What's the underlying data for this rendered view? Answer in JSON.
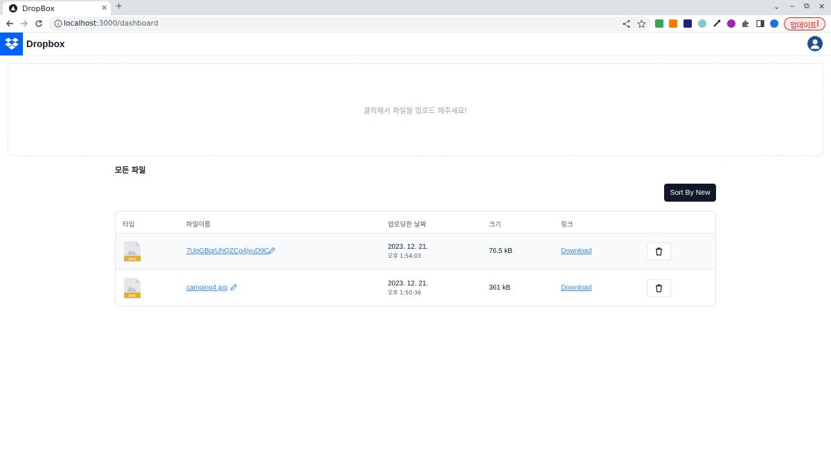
{
  "browser": {
    "tab_title": "DropBox",
    "tab_close": "✕",
    "new_tab": "+",
    "url_host": "localhost",
    "url_path": ":3000/dashboard",
    "update_label": "업데이트",
    "update_menu": "⋮",
    "window_controls": [
      "⌄",
      "–",
      "⧉",
      "✕"
    ]
  },
  "header": {
    "app_title": "Dropbox"
  },
  "dropzone": {
    "text": "클릭해서 파일을 업로드 해주세요!"
  },
  "files": {
    "section_title": "모든 파일",
    "sort_label": "Sort By New",
    "columns": [
      "타입",
      "파일이름",
      "업로딩한 날짜",
      "크기",
      "링크"
    ],
    "rows": [
      {
        "icon_label": "jpeg",
        "name": "7UpGBqrUhQZCg4jyuD9C",
        "date": "2023. 12. 21.",
        "time": "오후 1:54:03",
        "size": "76.5 kB",
        "link": "Download"
      },
      {
        "icon_label": "jpeg",
        "name": "camping4.jpg",
        "date": "2023. 12. 21.",
        "time": "오후 1:50:36",
        "size": "361 kB",
        "link": "Download"
      }
    ]
  },
  "colors": {
    "brand": "#0061fe",
    "primary_button": "#111827",
    "link": "#3b82f6",
    "update_pill": "#d93025"
  }
}
